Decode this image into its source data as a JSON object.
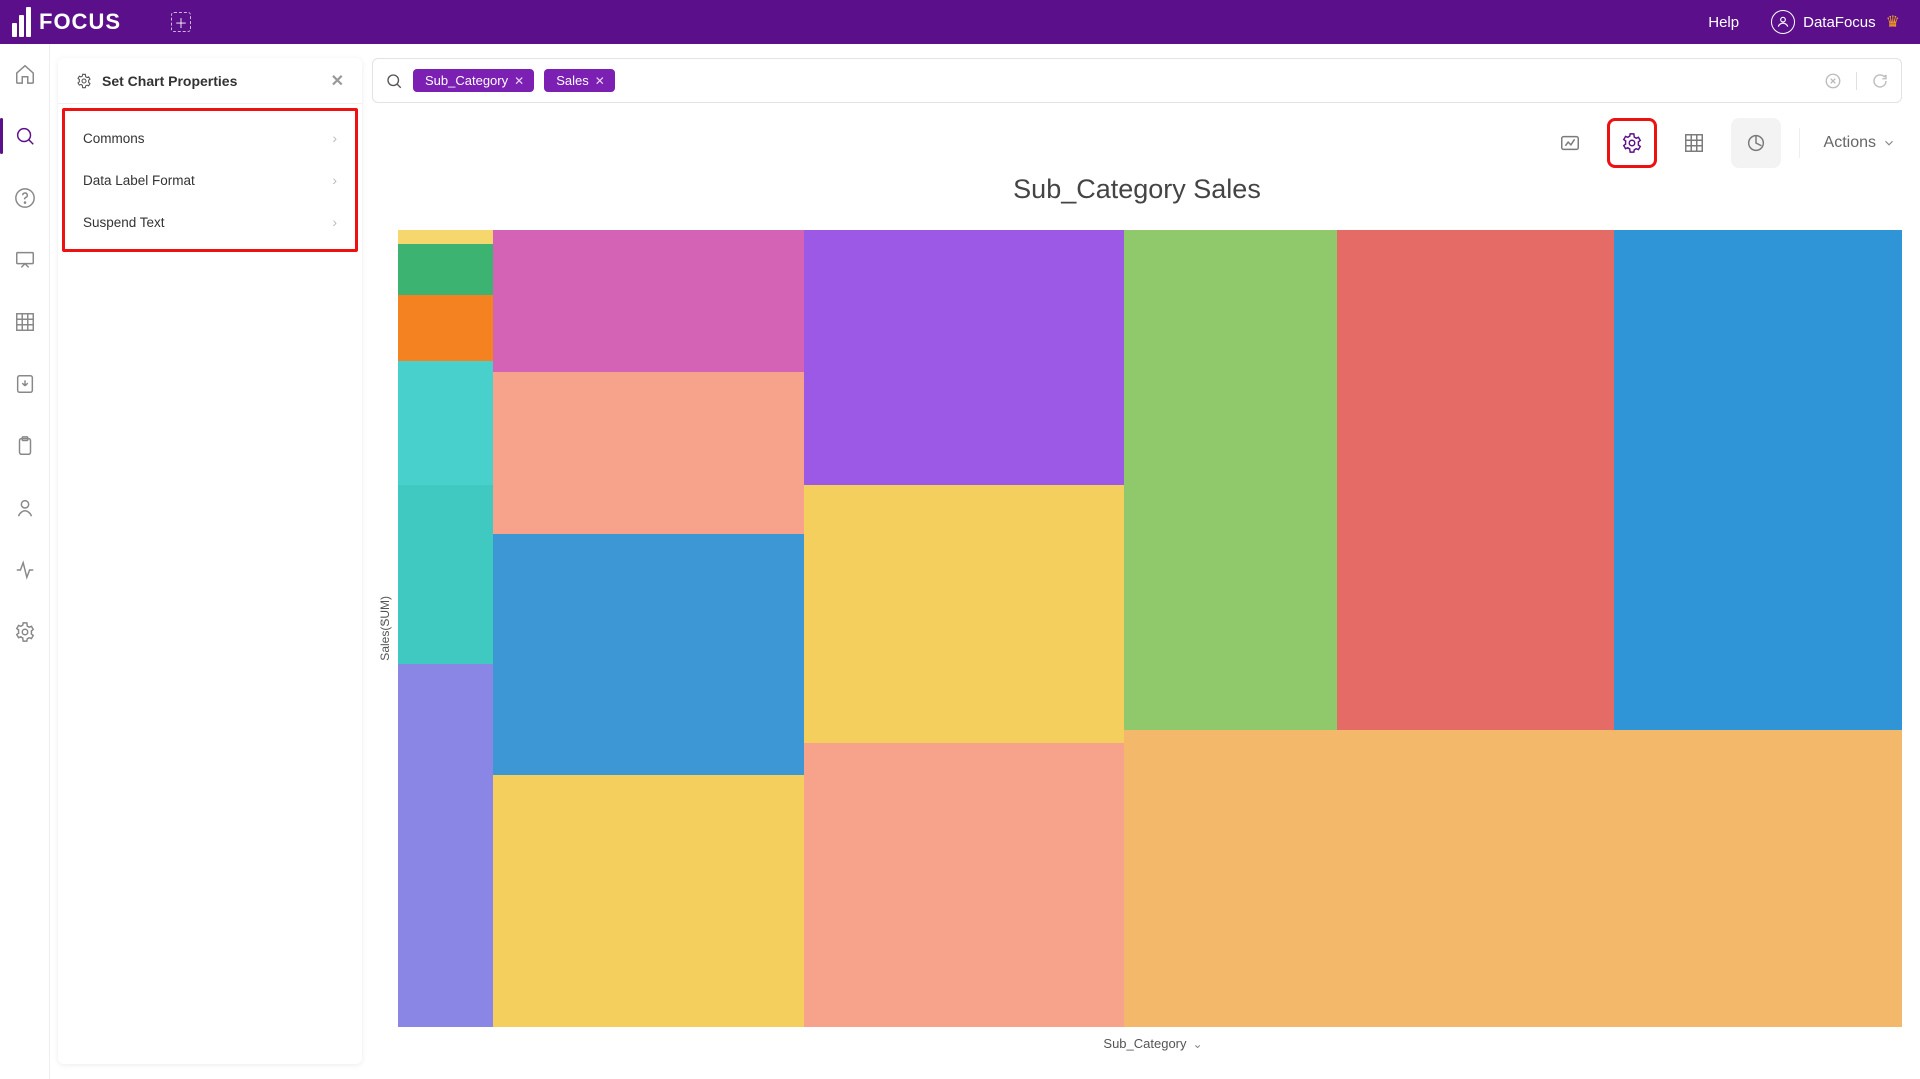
{
  "app": {
    "name": "FOCUS"
  },
  "topbar": {
    "help": "Help",
    "user": "DataFocus"
  },
  "panel": {
    "title": "Set Chart Properties",
    "items": [
      "Commons",
      "Data Label Format",
      "Suspend Text"
    ]
  },
  "search": {
    "chips": [
      "Sub_Category",
      "Sales"
    ]
  },
  "toolbar": {
    "actions_label": "Actions"
  },
  "chart": {
    "title": "Sub_Category Sales",
    "y_axis": "Sales(SUM)",
    "x_axis": "Sub_Category"
  },
  "chart_data": {
    "type": "heatmap",
    "description": "Marimekko / mosaic chart — column widths correspond to categories on the Sub_Category axis; within each column the coloured segments stack to 100% on the Sales(SUM) axis. No numeric tick labels are displayed, so segment sizes are expressed as fractions [0–1]. Column indices run left→right, segments top→bottom.",
    "xlabel": "Sub_Category",
    "ylabel": "Sales(SUM)",
    "legend": false,
    "columns": [
      {
        "index": 0,
        "width_frac": 0.063,
        "segments": [
          {
            "height_frac": 0.018,
            "color": "#f5d76e"
          },
          {
            "height_frac": 0.064,
            "color": "#3cb371"
          },
          {
            "height_frac": 0.083,
            "color": "#f58220"
          },
          {
            "height_frac": 0.155,
            "color": "#48d1cc"
          },
          {
            "height_frac": 0.225,
            "color": "#40c9c0"
          },
          {
            "height_frac": 0.455,
            "color": "#8a86e6"
          }
        ]
      },
      {
        "index": 1,
        "width_frac": 0.207,
        "segments": [
          {
            "height_frac": 0.178,
            "color": "#d463b6"
          },
          {
            "height_frac": 0.204,
            "color": "#f7a28b"
          },
          {
            "height_frac": 0.302,
            "color": "#3d97d4"
          },
          {
            "height_frac": 0.316,
            "color": "#f4cf5d"
          }
        ]
      },
      {
        "index": 2,
        "width_frac": 0.213,
        "segments": [
          {
            "height_frac": 0.32,
            "color": "#9b59e6"
          },
          {
            "height_frac": 0.324,
            "color": "#f4cf5d"
          },
          {
            "height_frac": 0.356,
            "color": "#f7a28b"
          }
        ]
      },
      {
        "index": 3,
        "width_frac": 0.517,
        "segments": [
          {
            "upper_row_height_frac": 0.627,
            "upper_row": [
              {
                "width_frac": 0.274,
                "color": "#8fc96b"
              },
              {
                "width_frac": 0.356,
                "color": "#e46b66"
              },
              {
                "width_frac": 0.37,
                "color": "#2f95d6"
              }
            ],
            "lower_height_frac": 0.373,
            "lower_color": "#f3b869"
          }
        ]
      }
    ]
  }
}
